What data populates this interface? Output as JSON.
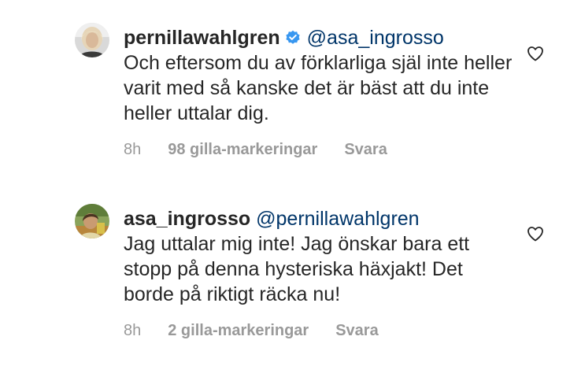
{
  "comments": [
    {
      "username": "pernillawahlgren",
      "verified": true,
      "mention": "@asa_ingrosso",
      "text": "Och eftersom du av förklarliga själ inte heller varit med så kanske det är bäst att du inte heller uttalar dig.",
      "time": "8h",
      "likes": "98 gilla-markeringar",
      "reply": "Svara",
      "avatar_icon": "profile-photo-blonde-woman",
      "like_icon": "heart-outline-icon"
    },
    {
      "username": "asa_ingrosso",
      "verified": false,
      "mention": "@pernillawahlgren",
      "text": "Jag uttalar mig inte! Jag önskar bara ett stopp på denna hysteriska häxjakt! Det borde på riktigt räcka nu!",
      "time": "8h",
      "likes": "2 gilla-markeringar",
      "reply": "Svara",
      "avatar_icon": "profile-photo-outdoor",
      "like_icon": "heart-outline-icon"
    }
  ],
  "colors": {
    "text": "#262626",
    "mention": "#003569",
    "meta": "#999999",
    "verified": "#3897f0"
  }
}
